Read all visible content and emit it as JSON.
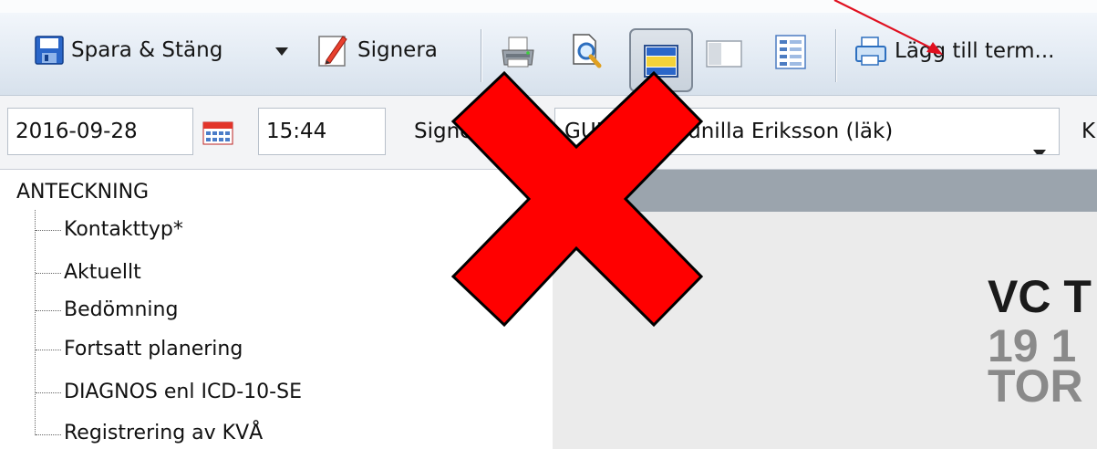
{
  "toolbar": {
    "save_close_label": "Spara & Stäng",
    "sign_label": "Signera",
    "add_term_label": "Lägg till term..."
  },
  "header": {
    "date_value": "2016-09-28",
    "time_value": "15:44",
    "signer_label": "Signerare",
    "signer_code": "GUNER",
    "signer_name": "Gunilla Eriksson (läk)",
    "next_label_partial": "K"
  },
  "tree": {
    "root": "ANTECKNING",
    "items": [
      "Kontakttyp*",
      "Aktuellt",
      "Bedömning",
      "Fortsatt planering",
      "DIAGNOS enl ICD-10-SE",
      "Registrering av KVÅ"
    ]
  },
  "preview": {
    "line1": "VC T",
    "line2": "19 1",
    "line3": "TOR"
  },
  "colors": {
    "overlay_x": "#ff0000",
    "annotation_arrow": "#e01020",
    "toolbar_bg": "#e2eaf3",
    "preview_header": "#9ba4ad"
  },
  "icons": [
    "save-icon",
    "dropdown-arrow-icon",
    "sign-icon",
    "print-icon",
    "print-preview-icon",
    "layout-horizontal-icon",
    "layout-vertical-icon",
    "layout-list-icon",
    "add-term-icon",
    "calendar-icon",
    "chevron-down-icon"
  ]
}
